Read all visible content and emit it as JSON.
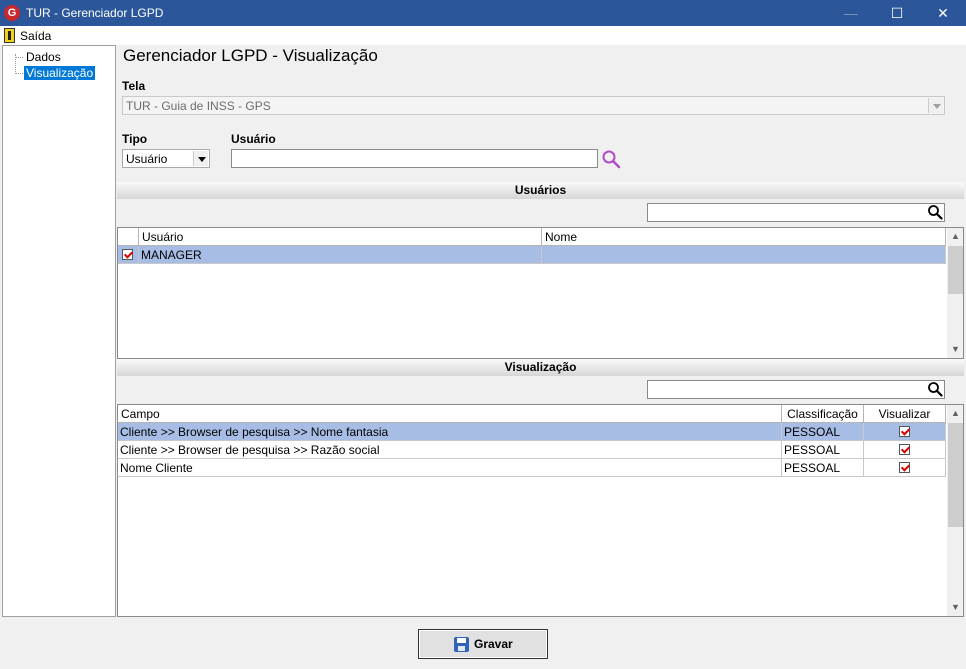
{
  "window": {
    "title": "TUR - Gerenciador LGPD",
    "icon_letter": "G",
    "minimize_glyph": "—",
    "maximize_glyph": "☐",
    "close_glyph": "✕"
  },
  "menu": {
    "exit_label": "Saída"
  },
  "tree": {
    "items": [
      "Dados",
      "Visualização"
    ],
    "selected": "Visualização"
  },
  "page": {
    "title": "Gerenciador LGPD - Visualização",
    "tela_label": "Tela",
    "tela_value": "TUR - Guia de INSS - GPS",
    "tipo_label": "Tipo",
    "tipo_value": "Usuário",
    "usuario_label": "Usuário",
    "usuario_value": ""
  },
  "usuarios": {
    "section_title": "Usuários",
    "search_value": "",
    "columns": [
      "Usuário",
      "Nome"
    ],
    "rows": [
      {
        "checked": true,
        "usuario": "MANAGER",
        "nome": ""
      }
    ]
  },
  "visualizacao": {
    "section_title": "Visualização",
    "search_value": "",
    "columns": [
      "Campo",
      "Classificação",
      "Visualizar"
    ],
    "rows": [
      {
        "campo": "Cliente >> Browser de pesquisa >> Nome fantasia",
        "classificacao": "PESSOAL",
        "visualizar": true
      },
      {
        "campo": "Cliente >> Browser de pesquisa >> Razão social",
        "classificacao": "PESSOAL",
        "visualizar": true
      },
      {
        "campo": "Nome Cliente",
        "classificacao": "PESSOAL",
        "visualizar": true
      }
    ]
  },
  "actions": {
    "save_label": "Gravar"
  },
  "colors": {
    "titlebar": "#2b579a",
    "selection": "#a8bde6",
    "tree_selection": "#0078d7",
    "checkmark": "#dd0000",
    "lupa_purple": "#b04cc8"
  }
}
